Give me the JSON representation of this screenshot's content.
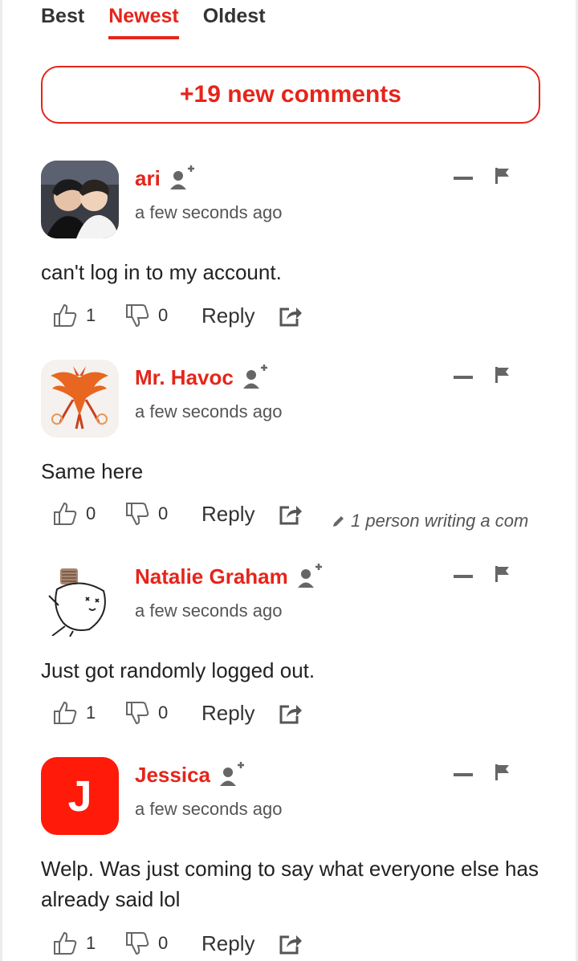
{
  "tabs": [
    {
      "label": "Best",
      "active": false
    },
    {
      "label": "Newest",
      "active": true
    },
    {
      "label": "Oldest",
      "active": false
    }
  ],
  "new_comments": {
    "label": "+19 new comments"
  },
  "colors": {
    "accent": "#e5251b",
    "icon": "#666666",
    "text": "#222222"
  },
  "comments": [
    {
      "author": "ari",
      "time": "a few seconds ago",
      "text": "can't log in to my account.",
      "likes": "1",
      "dislikes": "0",
      "reply": "Reply",
      "avatar": "photo-avatar"
    },
    {
      "author": "Mr. Havoc",
      "time": "a few seconds ago",
      "text": "Same here",
      "likes": "0",
      "dislikes": "0",
      "reply": "Reply",
      "avatar": "phoenix-avatar"
    },
    {
      "author": "Natalie Graham",
      "time": "a few seconds ago",
      "text": "Just got randomly logged out.",
      "likes": "1",
      "dislikes": "0",
      "reply": "Reply",
      "avatar": "sketch-avatar"
    },
    {
      "author": "Jessica",
      "time": "a few seconds ago",
      "text": "Welp. Was just coming to say what everyone else has already said lol",
      "likes": "1",
      "dislikes": "0",
      "reply": "Reply",
      "avatar": "letter-avatar",
      "avatar_letter": "J"
    }
  ],
  "typing_indicator": {
    "text": "1 person writing a com",
    "icon": "pencil-icon"
  }
}
